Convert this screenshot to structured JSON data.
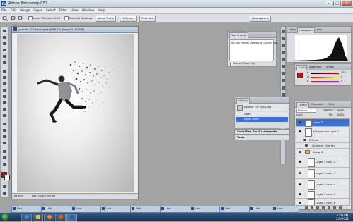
{
  "window": {
    "title": "Adobe Photoshop CS3"
  },
  "menu": [
    "File",
    "Edit",
    "Image",
    "Layer",
    "Select",
    "Filter",
    "View",
    "Window",
    "Help"
  ],
  "options": {
    "resize_windows": "Resize Windows To Fit",
    "zoom_all": "Zoom All Windows",
    "actual_pixels": "Actual Pixels",
    "fit_screen": "Fit Screen",
    "print_size": "Print Size",
    "workspace": "Workspace ▾"
  },
  "document": {
    "title": "parallel TCP backuped @ 66.7% (Layer 2, RGB/8)",
    "zoom": "66.67%",
    "doc_size": "Doc: 28.8M/396.6M"
  },
  "tool_presets": {
    "tab": "Tool Presets",
    "message": "No Tool Presets Defined for Current Tool.",
    "current_tool_only": "Current Tool Only"
  },
  "navigator": {
    "tabs": [
      "Navi",
      "Histogram",
      "Info"
    ]
  },
  "color_panel": {
    "tabs": [
      "Color",
      "Swatches",
      "Styles"
    ],
    "channels": [
      "R",
      "G",
      "B"
    ],
    "values": [
      "255",
      "0",
      "0"
    ]
  },
  "history": {
    "tab": "History",
    "items": [
      "parallel TCP bany.psd",
      "Open",
      "Layer Order"
    ],
    "selected": 2
  },
  "color_efex": {
    "label": "Color Efex Pro 3.0 Complete"
  },
  "tools_panel": {
    "label": "Tools"
  },
  "layers": {
    "tabs": [
      "Layers",
      "Channels",
      "Paths"
    ],
    "blend_mode": "Normal",
    "opacity_label": "Opacity:",
    "opacity": "100%",
    "lock_label": "Lock:",
    "fill_label": "Fill:",
    "fill": "100%",
    "items": [
      {
        "name": "Layer 2",
        "selected": true
      },
      {
        "name": "Background copy 2",
        "selected": false
      },
      {
        "name": "Effects",
        "selected": false
      },
      {
        "name": "Gradient Overlay",
        "selected": false
      },
      {
        "name": "Group 2",
        "selected": false
      },
      {
        "name": "Layer 3 copy 2",
        "selected": false
      },
      {
        "name": "Layer 3 copy 3",
        "selected": false
      },
      {
        "name": "Layer 3 copy 4",
        "selected": false
      },
      {
        "name": "Layer 3 copy 5",
        "selected": false
      },
      {
        "name": "Layer 3 copy 6",
        "selected": false
      }
    ]
  },
  "doc_tabs": [
    "Unti...",
    "Unti...",
    "Unti...",
    "Unti...",
    "Unti...",
    "Unti...",
    "Unti...",
    "Unti...",
    "Unti...",
    "Unti..."
  ],
  "colors": {
    "foreground": "#e00000",
    "background": "#ffffff",
    "selection": "#3c6fd3"
  },
  "taskbar": {
    "icons": [
      "start-orb",
      "ie-icon",
      "explorer-icon",
      "media-player-icon",
      "firefox-icon",
      "photoshop-icon"
    ],
    "time": "5:08 PM",
    "date": "2/9/2011"
  }
}
